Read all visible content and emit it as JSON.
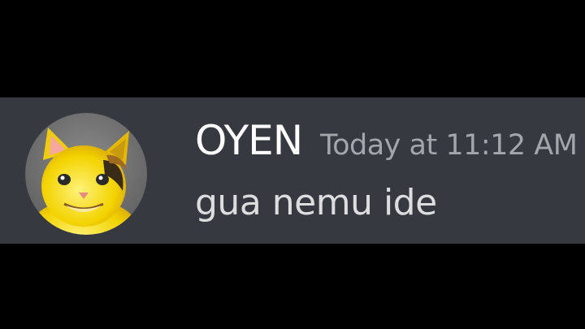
{
  "message": {
    "author": "OYEN",
    "timestamp": "Today at 11:12 AM",
    "content": "gua nemu ide",
    "avatar_icon": "cat-avatar-icon"
  },
  "colors": {
    "page_background": "#000000",
    "message_background": "#36393f",
    "username": "#ffffff",
    "timestamp": "#a3a6aa",
    "content_text": "#dcddde"
  }
}
